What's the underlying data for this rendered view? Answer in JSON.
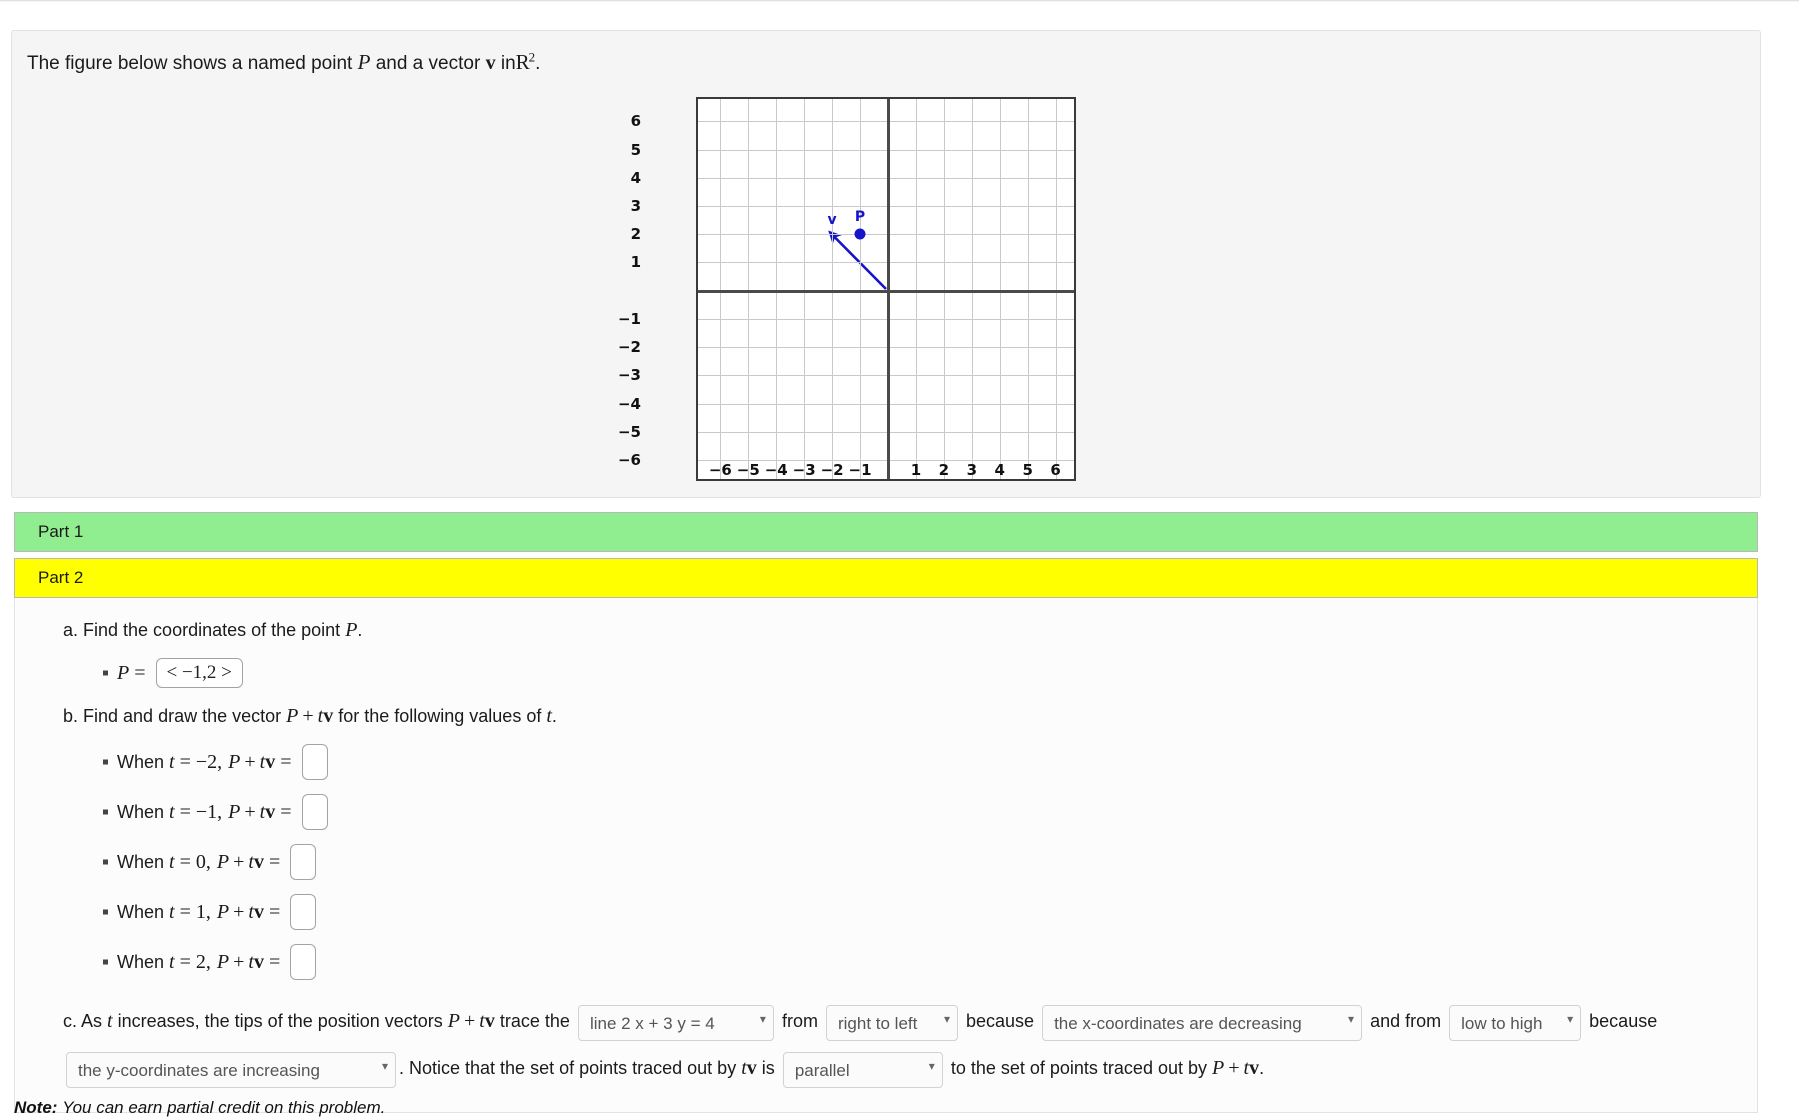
{
  "intro": {
    "text_before": "The figure below shows a named point",
    "point_symbol": "P",
    "text_middle": "and a vector",
    "vector_symbol": "v",
    "text_in": "in",
    "space_symbol": "R",
    "space_exponent": "2",
    "period": "."
  },
  "chart_data": {
    "type": "scatter",
    "title": "",
    "xlabel": "",
    "ylabel": "",
    "xlim": [
      -6.8,
      6.8
    ],
    "ylim": [
      -6.8,
      6.8
    ],
    "grid": true,
    "xticks": [
      -6,
      -5,
      -4,
      -3,
      -2,
      -1,
      1,
      2,
      3,
      4,
      5,
      6
    ],
    "yticks": [
      6,
      5,
      4,
      3,
      2,
      1,
      -1,
      -2,
      -3,
      -4,
      -5,
      -6
    ],
    "points": [
      {
        "label": "P",
        "x": -1,
        "y": 2,
        "color": "#1414c8"
      }
    ],
    "vectors": [
      {
        "label": "v",
        "x0": 0,
        "y0": 0,
        "x1": -2,
        "y1": 2,
        "color": "#1414c8"
      }
    ],
    "colors": {
      "point": "#1414c8",
      "vector": "#1414c8",
      "grid": "#c9c9c9",
      "axis": "#4a4a4a"
    }
  },
  "parts": {
    "part1_label": "Part 1",
    "part2_label": "Part 2",
    "part1_color": "#90ee90",
    "part2_color": "#ffff00"
  },
  "question_a": {
    "prompt_before": "a. Find the coordinates of the point",
    "prompt_symbol": "P",
    "prompt_after": ".",
    "lhs": "P",
    "equals": "=",
    "answer_value": "< −1,2 >"
  },
  "question_b": {
    "prompt_before": "b. Find and draw the vector",
    "prompt_expr_P": "P",
    "prompt_expr_plus": "+",
    "prompt_expr_t": "t",
    "prompt_expr_v": "v",
    "prompt_after": "for the following values of",
    "prompt_var": "t",
    "prompt_period": ".",
    "items": [
      {
        "when": "When",
        "t_var": "t",
        "eq1": "=",
        "t_value": "−2",
        "comma": ",",
        "expr_P": "P",
        "plus": "+",
        "expr_t": "t",
        "expr_v": "v",
        "eq2": "=",
        "answer_value": ""
      },
      {
        "when": "When",
        "t_var": "t",
        "eq1": "=",
        "t_value": "−1",
        "comma": ",",
        "expr_P": "P",
        "plus": "+",
        "expr_t": "t",
        "expr_v": "v",
        "eq2": "=",
        "answer_value": ""
      },
      {
        "when": "When",
        "t_var": "t",
        "eq1": "=",
        "t_value": "0",
        "comma": ",",
        "expr_P": "P",
        "plus": "+",
        "expr_t": "t",
        "expr_v": "v",
        "eq2": "=",
        "answer_value": ""
      },
      {
        "when": "When",
        "t_var": "t",
        "eq1": "=",
        "t_value": "1",
        "comma": ",",
        "expr_P": "P",
        "plus": "+",
        "expr_t": "t",
        "expr_v": "v",
        "eq2": "=",
        "answer_value": ""
      },
      {
        "when": "When",
        "t_var": "t",
        "eq1": "=",
        "t_value": "2",
        "comma": ",",
        "expr_P": "P",
        "plus": "+",
        "expr_t": "t",
        "expr_v": "v",
        "eq2": "=",
        "answer_value": ""
      }
    ]
  },
  "question_c": {
    "seg1": "c. As",
    "var_t": "t",
    "seg2": "increases, the tips of the position vectors",
    "expr_P": "P",
    "expr_plus": "+",
    "expr_t": "t",
    "expr_v": "v",
    "seg3": "trace the",
    "dd_line_value": "line 2 x + 3 y = 4",
    "seg4": "from",
    "dd_direction_value": "right to left",
    "seg5": "because",
    "dd_reason_x_value": "the x-coordinates are decreasing",
    "seg6": "and from",
    "dd_lowhigh_value": "low to high",
    "seg7": "because",
    "dd_reason_y_value": "the y-coordinates are increasing",
    "seg8": ". Notice that the set of points traced out by",
    "expr2_t": "t",
    "expr2_v": "v",
    "seg9": "is",
    "dd_parallel_value": "parallel",
    "seg10": "to the set of points traced out by",
    "expr3_P": "P",
    "expr3_plus": "+",
    "expr3_t": "t",
    "expr3_v": "v",
    "seg11": "."
  },
  "footer": {
    "note_label": "Note:",
    "note_text": "You can earn partial credit on this problem."
  }
}
